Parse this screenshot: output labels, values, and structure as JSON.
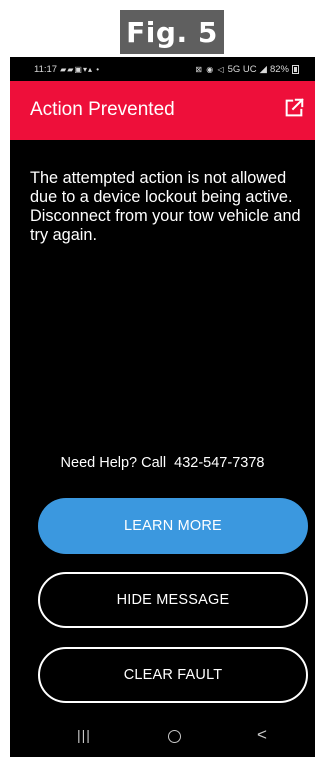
{
  "figure_label": "Fig. 5",
  "status_bar": {
    "time": "11:17",
    "left_icons": "▰▰▣▾▴ •",
    "right_icons": "⊠ ◉ ◁",
    "network": "5G UC",
    "signal": "◢",
    "battery": "82%"
  },
  "header": {
    "title": "Action Prevented",
    "icon": "external-link-icon",
    "background": "#ee0f3a"
  },
  "message": "The attempted action is not allowed due to a device lockout being active. Disconnect from your tow vehicle and try again.",
  "help": {
    "prefix": "Need Help? Call",
    "phone": "432-547-7378"
  },
  "buttons": {
    "learn_more": "LEARN MORE",
    "hide_message": "HIDE MESSAGE",
    "clear_fault": "CLEAR FAULT"
  },
  "nav": {
    "recents": "|||",
    "back": "<"
  },
  "colors": {
    "accent_blue": "#3b98df",
    "alert_red": "#ee0f3a"
  }
}
